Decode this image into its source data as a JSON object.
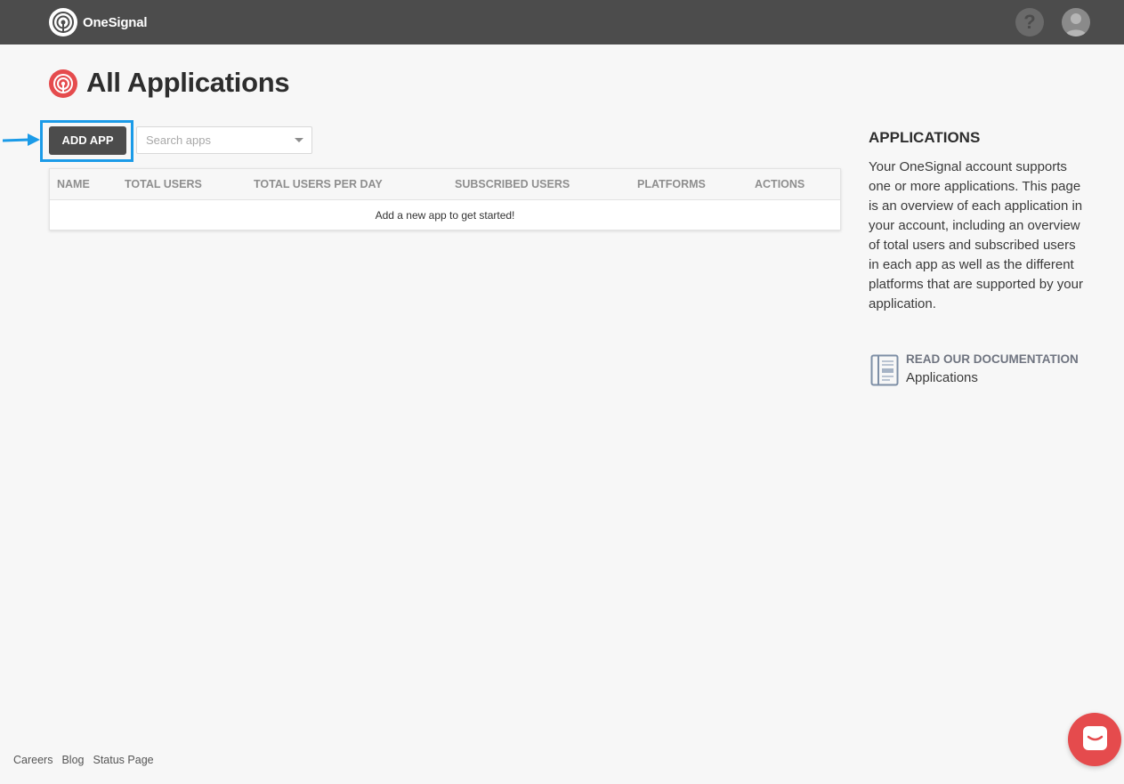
{
  "header": {
    "brand_name": "OneSignal",
    "help_label": "?",
    "logo_icon": "onesignal-logo-icon",
    "avatar_icon": "user-avatar-icon"
  },
  "page": {
    "title": "All Applications",
    "title_icon": "onesignal-app-icon"
  },
  "toolbar": {
    "add_app_label": "ADD APP",
    "search_placeholder": "Search apps",
    "highlight_color": "#1b9be8"
  },
  "table": {
    "columns": [
      "NAME",
      "TOTAL USERS",
      "TOTAL USERS PER DAY",
      "SUBSCRIBED USERS",
      "PLATFORMS",
      "ACTIONS"
    ],
    "empty_message": "Add a new app to get started!"
  },
  "sidebar": {
    "title": "APPLICATIONS",
    "description": "Your OneSignal account supports one or more applications. This page is an overview of each application in your account, including an overview of total users and subscribed users in each app as well as the different platforms that are supported by your application.",
    "doc_link_label": "READ OUR DOCUMENTATION",
    "doc_link_sub": "Applications",
    "doc_icon": "document-icon"
  },
  "footer": {
    "links": [
      "Careers",
      "Blog",
      "Status Page"
    ]
  },
  "chat": {
    "icon": "chat-icon"
  },
  "colors": {
    "topbar": "#4c4c4c",
    "brand_red": "#e54b4d",
    "background": "#f7f7f7"
  }
}
